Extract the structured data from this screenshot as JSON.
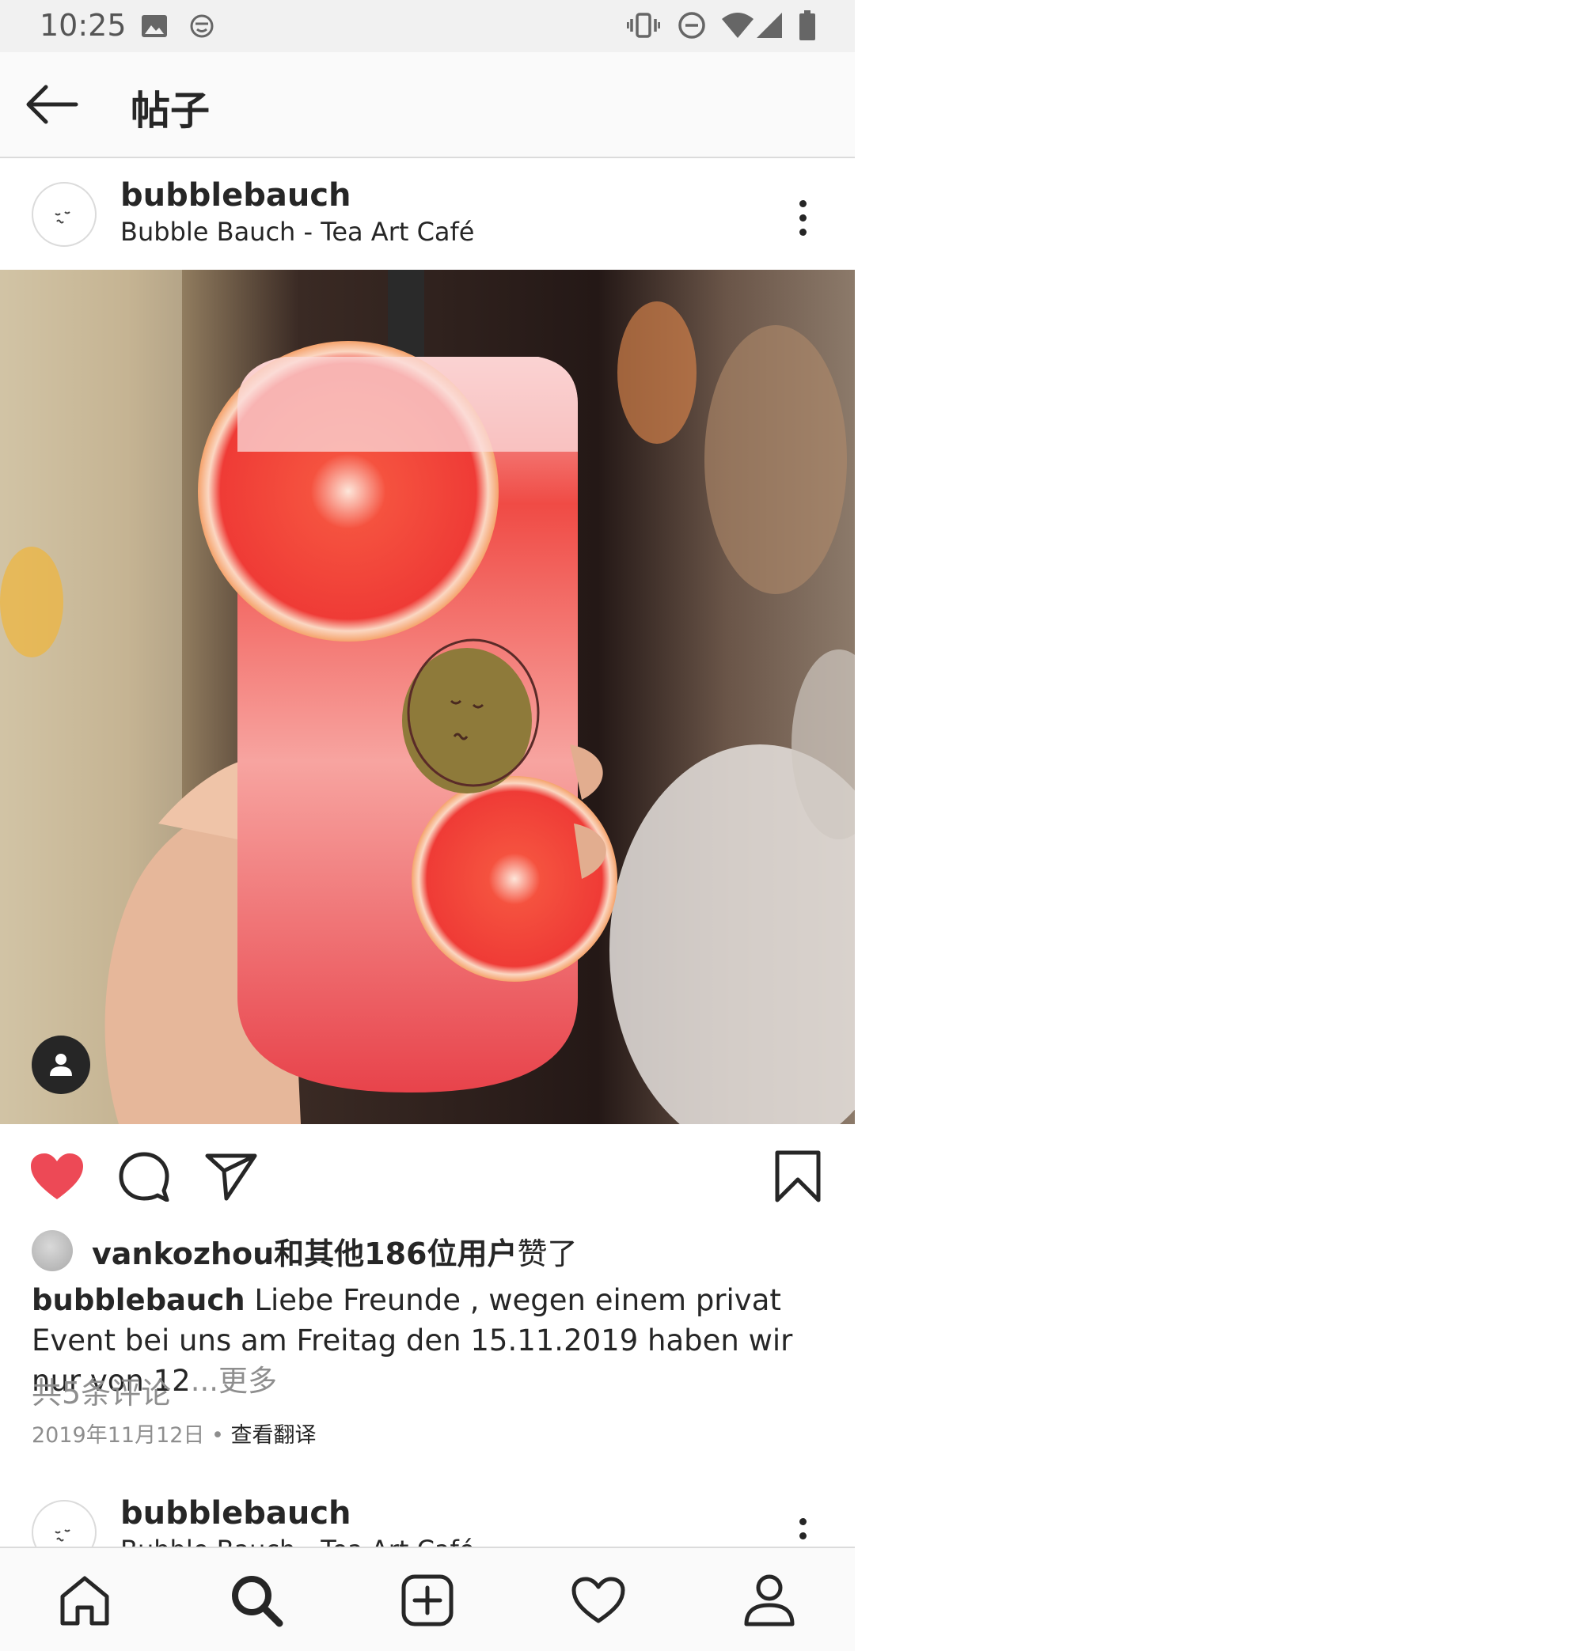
{
  "status_bar": {
    "time": "10:25",
    "left_icons": [
      "image-icon",
      "assistant-face-icon"
    ],
    "right_icons": [
      "vibrate-icon",
      "do-not-disturb-icon",
      "wifi-icon",
      "cell-signal-icon",
      "battery-icon"
    ]
  },
  "app_bar": {
    "title": "帖子",
    "back_icon": "arrow-left-icon"
  },
  "post": {
    "username": "bubblebauch",
    "location": "Bubble Bauch - Tea Art Café",
    "image_description_icon": "drink-photo",
    "liked": true,
    "likes": {
      "bold": "vankozhou和其他186位用户",
      "suffix": "赞了"
    },
    "caption": {
      "user": "bubblebauch",
      "text": " Liebe Freunde , wegen einem privat Event bei uns am Freitag den 15.11.2019 haben wir nur von 12",
      "more": "...更多"
    },
    "comments_link": "共5条评论",
    "date": "2019年11月12日",
    "separator": " • ",
    "translate": "查看翻译"
  },
  "next_post": {
    "username": "bubblebauch",
    "location": "Bubble Bauch - Tea Art Café"
  },
  "colors": {
    "like_red": "#ed4956",
    "text": "#262626",
    "muted": "#8e8e8e"
  },
  "bottom_nav": [
    "home-icon",
    "search-icon",
    "new-post-icon",
    "activity-icon",
    "profile-icon"
  ]
}
